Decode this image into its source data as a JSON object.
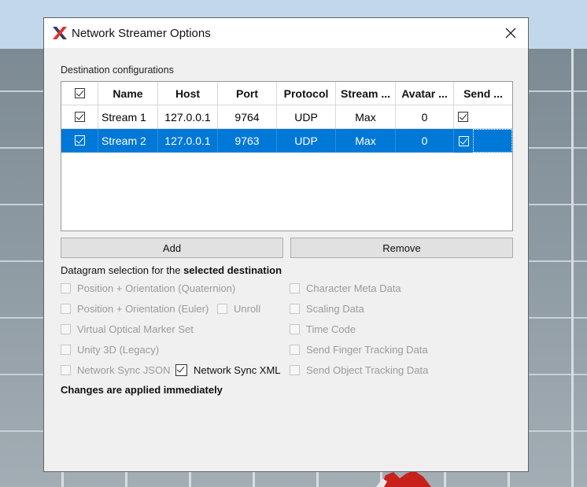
{
  "window": {
    "title": "Network Streamer Options",
    "close_symbol": "✕"
  },
  "destinations": {
    "section_label": "Destination configurations",
    "columns": [
      "Name",
      "Host",
      "Port",
      "Protocol",
      "Stream ...",
      "Avatar ...",
      "Send ..."
    ],
    "header_checked": true,
    "rows": [
      {
        "checked": true,
        "name": "Stream 1",
        "host": "127.0.0.1",
        "port": "9764",
        "protocol": "UDP",
        "stream": "Max",
        "avatar": "0",
        "send": true,
        "selected": false
      },
      {
        "checked": true,
        "name": "Stream 2",
        "host": "127.0.0.1",
        "port": "9763",
        "protocol": "UDP",
        "stream": "Max",
        "avatar": "0",
        "send": true,
        "selected": true
      }
    ]
  },
  "buttons": {
    "add": "Add",
    "remove": "Remove"
  },
  "datagram": {
    "label_prefix": "Datagram selection for the ",
    "label_bold": "selected destination",
    "options": {
      "pos_quat": {
        "label": "Position + Orientation (Quaternion)",
        "checked": false,
        "enabled": false
      },
      "pos_euler": {
        "label": "Position + Orientation (Euler)",
        "checked": false,
        "enabled": false
      },
      "unroll": {
        "label": "Unroll",
        "checked": false,
        "enabled": false
      },
      "virtual_marker": {
        "label": "Virtual Optical Marker Set",
        "checked": false,
        "enabled": false
      },
      "unity": {
        "label": "Unity 3D (Legacy)",
        "checked": false,
        "enabled": false
      },
      "sync_json": {
        "label": "Network Sync JSON",
        "checked": false,
        "enabled": false
      },
      "sync_xml": {
        "label": "Network Sync XML",
        "checked": true,
        "enabled": true
      },
      "char_meta": {
        "label": "Character Meta Data",
        "checked": false,
        "enabled": false
      },
      "scaling": {
        "label": "Scaling Data",
        "checked": false,
        "enabled": false
      },
      "timecode": {
        "label": "Time Code",
        "checked": false,
        "enabled": false
      },
      "finger": {
        "label": "Send Finger Tracking Data",
        "checked": false,
        "enabled": false
      },
      "object": {
        "label": "Send Object Tracking Data",
        "checked": false,
        "enabled": false
      }
    }
  },
  "footer_note": "Changes are applied immediately",
  "colors": {
    "selection": "#0078d7",
    "logo_dark": "#3a3f5c",
    "logo_red": "#e0312f"
  }
}
